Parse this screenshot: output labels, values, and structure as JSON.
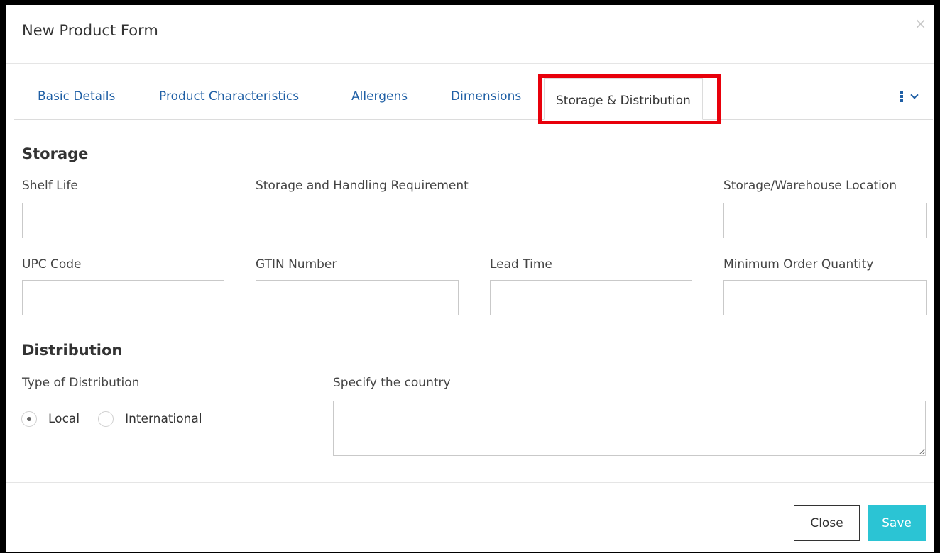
{
  "dialog": {
    "title": "New Product Form",
    "close_symbol": "×"
  },
  "tabs": [
    {
      "label": "Basic Details",
      "active": false
    },
    {
      "label": "Product Characteristics",
      "active": false
    },
    {
      "label": "Allergens",
      "active": false
    },
    {
      "label": "Dimensions",
      "active": false
    },
    {
      "label": "Storage & Distribution",
      "active": true
    }
  ],
  "tab_more_icons": [
    "kebab-menu-icon",
    "chevron-down-icon"
  ],
  "storage": {
    "title": "Storage",
    "shelf_life": {
      "label": "Shelf Life",
      "value": ""
    },
    "handling": {
      "label": "Storage and Handling Requirement",
      "value": ""
    },
    "warehouse": {
      "label": "Storage/Warehouse Location",
      "value": ""
    },
    "upc": {
      "label": "UPC Code",
      "value": ""
    },
    "gtin": {
      "label": "GTIN Number",
      "value": ""
    },
    "lead_time": {
      "label": "Lead Time",
      "value": ""
    },
    "min_order": {
      "label": "Minimum Order Quantity",
      "value": ""
    }
  },
  "distribution": {
    "title": "Distribution",
    "type_label": "Type of Distribution",
    "options": [
      {
        "label": "Local",
        "selected": true
      },
      {
        "label": "International",
        "selected": false
      }
    ],
    "country": {
      "label": "Specify the country",
      "value": ""
    }
  },
  "footer": {
    "close_label": "Close",
    "save_label": "Save"
  },
  "colors": {
    "link": "#1f5fa5",
    "highlight": "#e8000b",
    "save_button": "#2bc4d4"
  }
}
